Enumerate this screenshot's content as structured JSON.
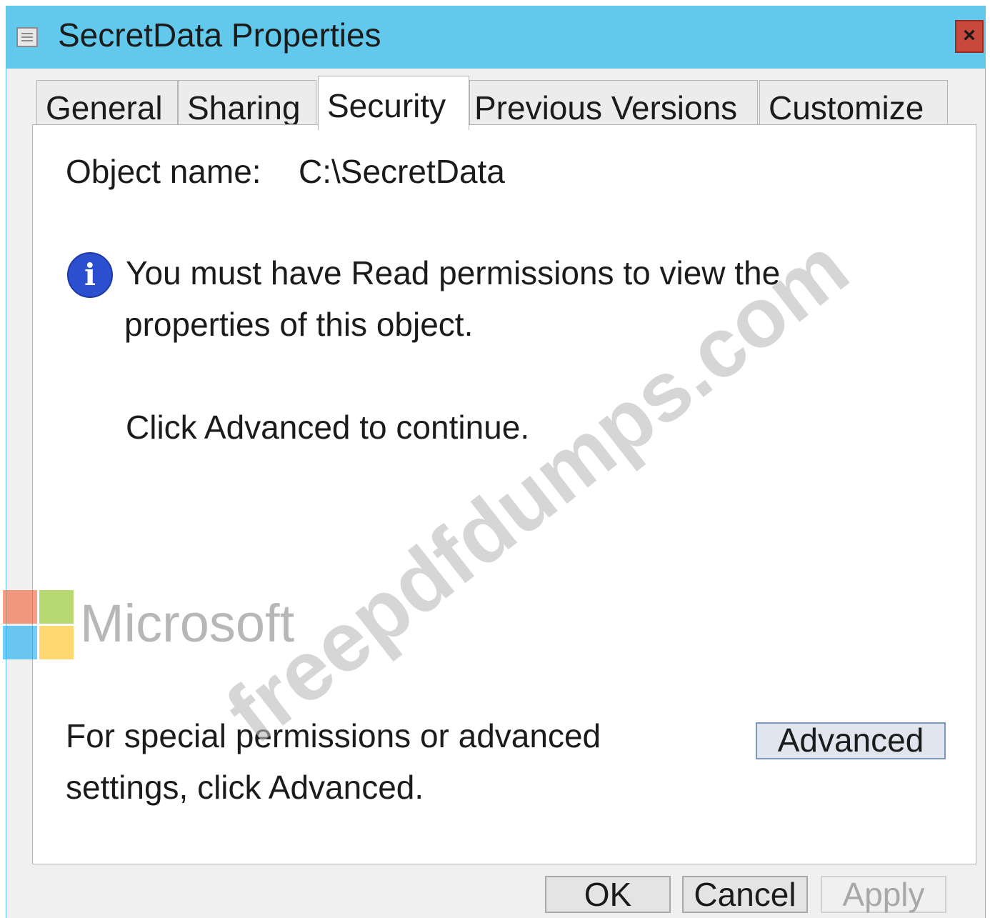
{
  "window": {
    "title": "SecretData Properties",
    "close_glyph": "×",
    "title_icon": "folder-properties-icon",
    "title_bar_color": "#62c8ec"
  },
  "tabs": [
    {
      "label": "General",
      "selected": false
    },
    {
      "label": "Sharing",
      "selected": false
    },
    {
      "label": "Security",
      "selected": true
    },
    {
      "label": "Previous Versions",
      "selected": false
    },
    {
      "label": "Customize",
      "selected": false
    }
  ],
  "security": {
    "object_name_label": "Object name:",
    "object_name_value": "C:\\SecretData",
    "info_icon": "information-icon",
    "info_glyph": "i",
    "message_line1": "You must have Read permissions to view the",
    "message_line2": "properties of this object.",
    "continue_text": "Click Advanced to continue.",
    "advanced_hint_line1": "For special permissions or advanced",
    "advanced_hint_line2": "settings, click Advanced.",
    "advanced_label": "Advanced"
  },
  "footer": {
    "ok_label": "OK",
    "cancel_label": "Cancel",
    "apply_label": "Apply",
    "apply_enabled": false
  },
  "overlays": {
    "microsoft_text": "Microsoft",
    "microsoft_logo_colors": [
      "#f25022",
      "#7fba00",
      "#00a4ef",
      "#ffb900"
    ],
    "watermark_text": "freepdfdumps.com"
  }
}
